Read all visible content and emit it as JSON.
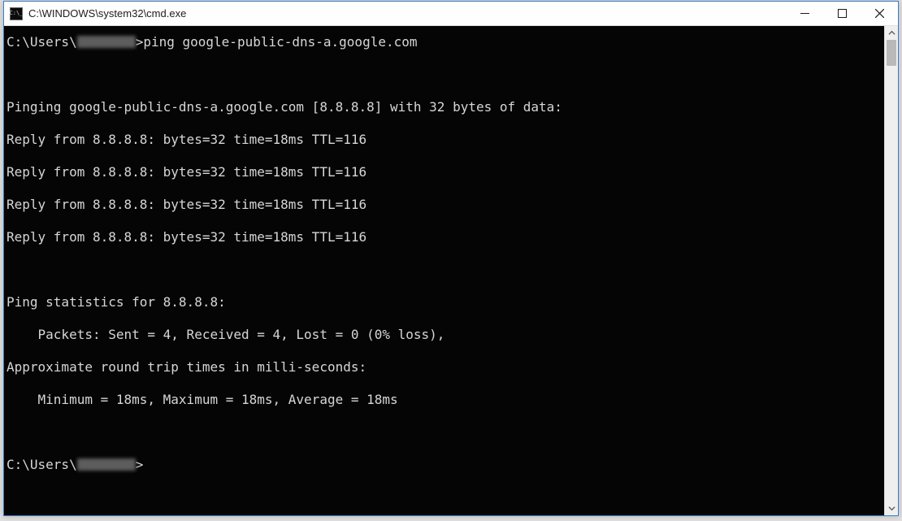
{
  "window": {
    "title": "C:\\WINDOWS\\system32\\cmd.exe"
  },
  "terminal": {
    "prompt_prefix": "C:\\Users\\",
    "prompt_suffix": ">",
    "command": "ping google-public-dns-a.google.com",
    "blank": "",
    "pinging_line": "Pinging google-public-dns-a.google.com [8.8.8.8] with 32 bytes of data:",
    "reply1": "Reply from 8.8.8.8: bytes=32 time=18ms TTL=116",
    "reply2": "Reply from 8.8.8.8: bytes=32 time=18ms TTL=116",
    "reply3": "Reply from 8.8.8.8: bytes=32 time=18ms TTL=116",
    "reply4": "Reply from 8.8.8.8: bytes=32 time=18ms TTL=116",
    "stats_header": "Ping statistics for 8.8.8.8:",
    "packets_line": "    Packets: Sent = 4, Received = 4, Lost = 0 (0% loss),",
    "approx_line": "Approximate round trip times in milli-seconds:",
    "minmax_line": "    Minimum = 18ms, Maximum = 18ms, Average = 18ms"
  }
}
